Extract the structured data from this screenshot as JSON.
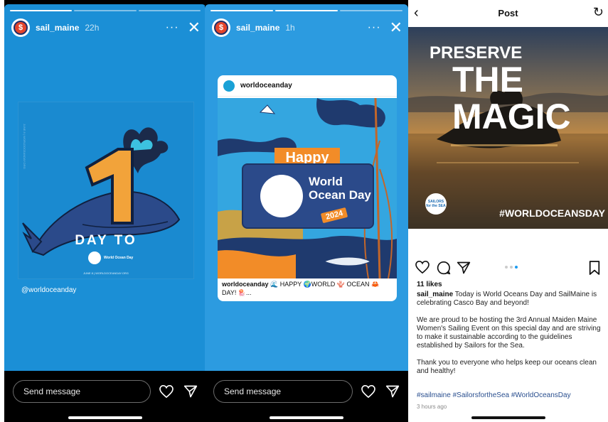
{
  "story1": {
    "username": "sail_maine",
    "time": "22h",
    "more": "···",
    "poster": {
      "number": "1",
      "line1": "DAY TO",
      "logo_text": "World Ocean Day",
      "url": "JUNE 8 | WORLDOCEANDAY.ORG"
    },
    "mention": "@worldoceanday",
    "reply_placeholder": "Send message"
  },
  "story2": {
    "username": "sail_maine",
    "time": "1h",
    "more": "···",
    "card": {
      "user": "worldoceanday",
      "happy": "Happy",
      "title": "World Ocean Day",
      "year": "2024",
      "caption_user": "worldoceanday",
      "caption_text": "🌊 HAPPY 🌍WORLD 🪸 OCEAN 🦀 DAY! 🪼..."
    },
    "reply_placeholder": "Send message"
  },
  "post": {
    "header_title": "Post",
    "image": {
      "line1": "PRESERVE",
      "line2": "THE MAGIC",
      "hashtag": "#WORLDOCEANSDAY",
      "badge": "SAILORS for the SEA"
    },
    "likes": "11 likes",
    "caption_user": "sail_maine",
    "caption_p1": "Today is World Oceans Day and SailMaine is celebrating Casco Bay and beyond!",
    "caption_p2": "We are proud to be hosting the 3rd Annual Maiden Maine Women's Sailing Event on this special day and are striving to make it sustainable according to the guidelines established by Sailors for the Sea.",
    "caption_p3": "Thank you to everyone who helps keep our oceans clean and healthy!",
    "hashtags": "#sailmaine #SailorsfortheSea #WorldOceansDay",
    "time_ago": "3 hours ago"
  }
}
